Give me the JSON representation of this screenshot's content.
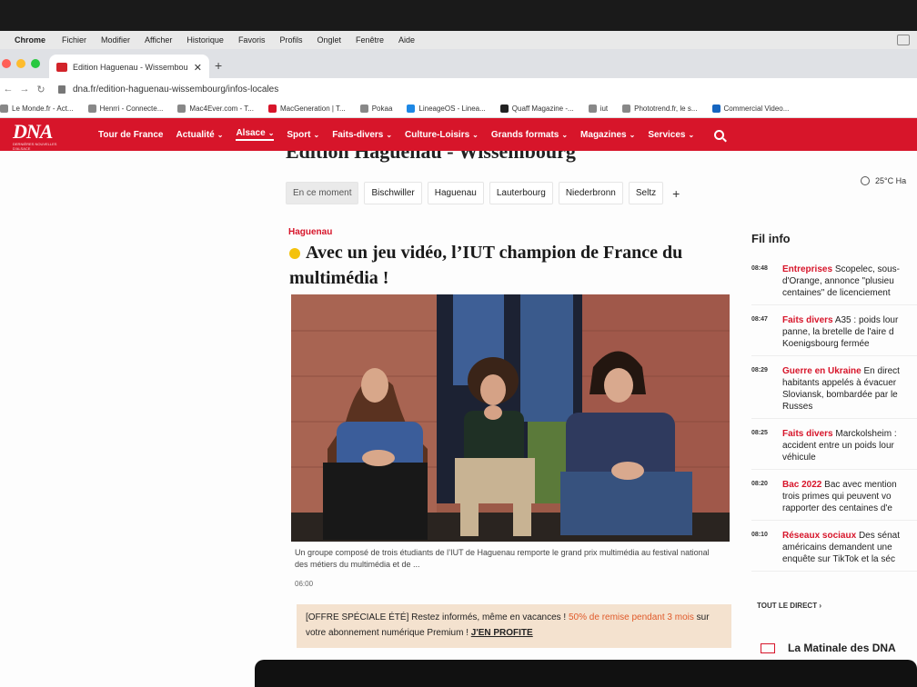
{
  "menubar": {
    "items": [
      "Chrome",
      "Fichier",
      "Modifier",
      "Afficher",
      "Historique",
      "Favoris",
      "Profils",
      "Onglet",
      "Fenêtre",
      "Aide"
    ]
  },
  "browser": {
    "tab_title": "Edition Haguenau - Wissembou",
    "url": "dna.fr/edition-haguenau-wissembourg/infos-locales",
    "bookmarks": [
      "Le Monde.fr - Act...",
      "Henrri - Connecte...",
      "Mac4Ever.com - T...",
      "MacGeneration | T...",
      "Pokaa",
      "LineageOS - Linea...",
      "Quaff Magazine -...",
      "iut",
      "Phototrend.fr, le s...",
      "Commercial Video..."
    ]
  },
  "site": {
    "logo": "DNA",
    "logo_sub": "DERNIÈRES NOUVELLES D'ALSACE",
    "nav": [
      {
        "label": "Tour de France",
        "caret": false,
        "active": false
      },
      {
        "label": "Actualité",
        "caret": true,
        "active": false
      },
      {
        "label": "Alsace",
        "caret": true,
        "active": true
      },
      {
        "label": "Sport",
        "caret": true,
        "active": false
      },
      {
        "label": "Faits-divers",
        "caret": true,
        "active": false
      },
      {
        "label": "Culture-Loisirs",
        "caret": true,
        "active": false
      },
      {
        "label": "Grands formats",
        "caret": true,
        "active": false
      },
      {
        "label": "Magazines",
        "caret": true,
        "active": false
      },
      {
        "label": "Services",
        "caret": true,
        "active": false
      }
    ]
  },
  "page": {
    "edition_title": "Edition Haguenau - Wissembourg",
    "subtabs": [
      "En ce moment",
      "Bischwiller",
      "Haguenau",
      "Lauterbourg",
      "Niederbronn",
      "Seltz"
    ],
    "weather": "25°C Ha",
    "article": {
      "kicker": "Haguenau",
      "headline": "Avec un jeu vidéo, l’IUT champion de France du multimédia !",
      "caption": "Un groupe composé de trois étudiants de l’IUT de Haguenau remporte le grand prix multimédia au festival national des métiers du multimédia et de ...",
      "time": "06:00"
    },
    "promo": {
      "tag": "[OFFRE SPÉCIALE ÉTÉ]",
      "text1": "Restez informés, même en vacances !",
      "highlight": "50% de remise pendant 3 mois",
      "text2": "sur votre abonnement numérique Premium !",
      "cta": "J'EN PROFITE"
    }
  },
  "filinfo": {
    "title": "Fil info",
    "items": [
      {
        "time": "08:48",
        "category": "Entreprises",
        "lines": [
          "Scopelec, sous-",
          "d'Orange, annonce \"plusieu",
          "centaines\" de licenciement"
        ]
      },
      {
        "time": "08:47",
        "category": "Faits divers",
        "lines": [
          "A35 : poids lour",
          "panne, la bretelle de l'aire d",
          "Koenigsbourg fermée"
        ]
      },
      {
        "time": "08:29",
        "category": "Guerre en Ukraine",
        "lines": [
          "En direct",
          "habitants appelés à évacuer",
          "Sloviansk, bombardée par le",
          "Russes"
        ]
      },
      {
        "time": "08:25",
        "category": "Faits divers",
        "lines": [
          "Marckolsheim :",
          "accident entre un poids lour",
          "véhicule"
        ]
      },
      {
        "time": "08:20",
        "category": "Bac 2022",
        "lines": [
          "Bac avec mention",
          "trois primes qui peuvent vo",
          "rapporter des centaines d'e"
        ]
      },
      {
        "time": "08:10",
        "category": "Réseaux sociaux",
        "lines": [
          "Des sénat",
          "américains demandent une",
          "enquête sur TikTok et la séc"
        ]
      }
    ],
    "direct_label": "TOUT LE DIRECT",
    "newsletter": "La Matinale des DNA"
  }
}
